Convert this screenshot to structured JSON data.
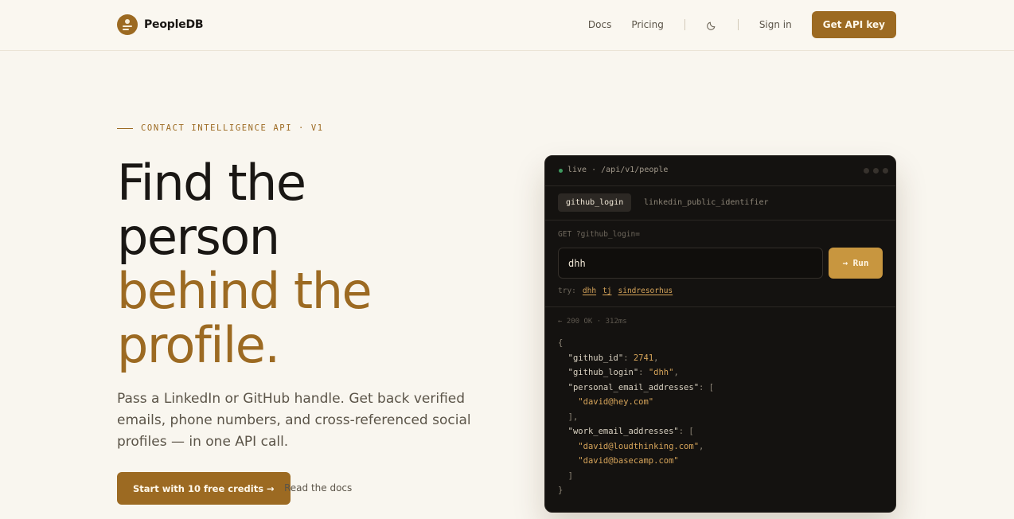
{
  "header": {
    "brand": "PeopleDB",
    "nav": {
      "docs": "Docs",
      "pricing": "Pricing",
      "sign_in": "Sign in",
      "get_api_key": "Get API key"
    }
  },
  "hero": {
    "eyebrow": "CONTACT INTELLIGENCE API · V1",
    "headline_dark_1": "Find the",
    "headline_dark_2": "person",
    "headline_gold_1": "behind the",
    "headline_gold_2": "profile.",
    "lede": "Pass a LinkedIn or GitHub handle. Get back verified emails, phone numbers, and cross-referenced social profiles — in one API call.",
    "cta_primary": "Start with 10 free credits →",
    "cta_secondary": "Read the docs"
  },
  "console": {
    "route": "live · /api/v1/people",
    "tabs": [
      "github_login",
      "linkedin_public_identifier"
    ],
    "method_line": "GET ?github_login=",
    "input_value": "dhh",
    "run_label": "→ Run",
    "try_label": "try:",
    "try_examples": [
      "dhh",
      "tj",
      "sindresorhus"
    ],
    "status": "← 200 OK · 312ms",
    "response": {
      "github_id": "2741",
      "github_login": "\"dhh\"",
      "personal_email_1": "\"david@hey.com\"",
      "work_email_1": "\"david@loudthinking.com\"",
      "work_email_2": "\"david@basecamp.com\""
    }
  },
  "colors": {
    "accent": "#9c6a22",
    "background": "#f9f6ef",
    "console_bg": "#141210",
    "live_dot": "#3f9a5f"
  }
}
